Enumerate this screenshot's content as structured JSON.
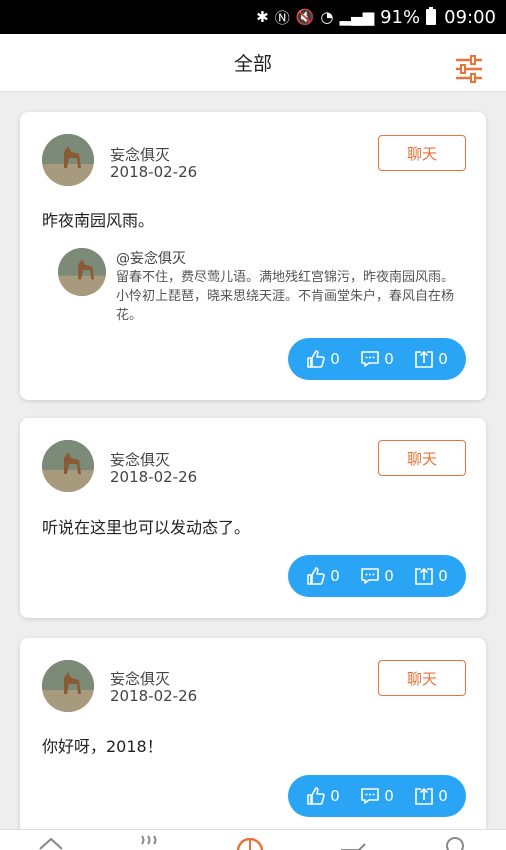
{
  "status_bar": {
    "battery": "91%",
    "time": "09:00"
  },
  "header": {
    "title": "全部"
  },
  "colors": {
    "accent": "#e8743b",
    "action_blue": "#2aa4f4"
  },
  "posts": [
    {
      "user": "妄念俱灭",
      "date": "2018-02-26",
      "chat_label": "聊天",
      "text": "昨夜南园风雨。",
      "quote": {
        "author": "@妄念俱灭",
        "body": "留春不住，费尽莺儿语。满地残红宫锦污，昨夜南园风雨。小怜初上琵琶，晓来思绕天涯。不肯画堂朱户，春风自在杨花。"
      },
      "likes": "0",
      "comments": "0",
      "shares": "0"
    },
    {
      "user": "妄念俱灭",
      "date": "2018-02-26",
      "chat_label": "聊天",
      "text": "听说在这里也可以发动态了。",
      "likes": "0",
      "comments": "0",
      "shares": "0"
    },
    {
      "user": "妄念俱灭",
      "date": "2018-02-26",
      "chat_label": "聊天",
      "text": "你好呀，2018！",
      "likes": "0",
      "comments": "0",
      "shares": "0"
    }
  ],
  "icons": [
    "bluetooth-icon",
    "nfc-icon",
    "mute-icon",
    "wifi-icon",
    "signal-icon",
    "battery-icon",
    "filter-icon",
    "like-icon",
    "comment-icon",
    "share-icon",
    "home-icon",
    "hot-icon",
    "basketball-icon",
    "car-icon",
    "profile-icon"
  ]
}
